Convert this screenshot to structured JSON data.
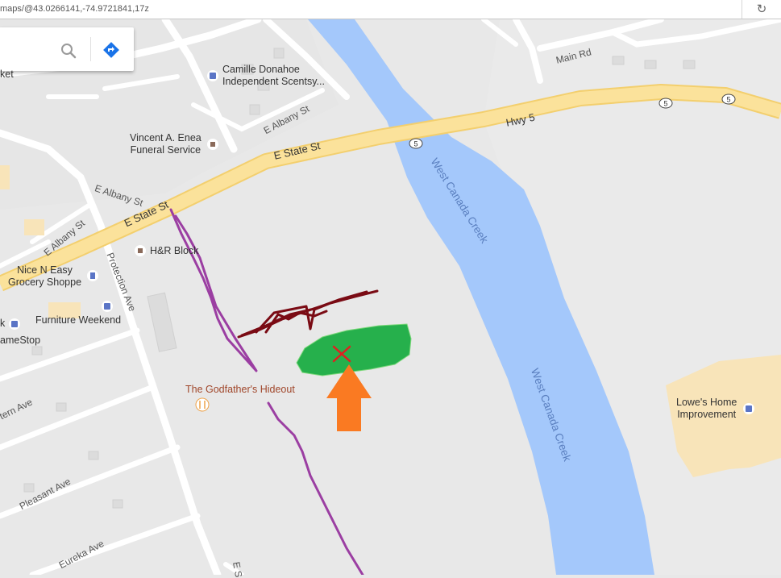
{
  "browser": {
    "url": "maps/@43.0266141,-74.9721841,17z"
  },
  "colors": {
    "land": "#e8e8e8",
    "water": "#a4c8fb",
    "highway": "#fbe29b",
    "highway_stroke": "#f3cf6e",
    "local_road": "#ffffff",
    "commercial": "#f8e4b9",
    "purple_path": "#9b3ea2",
    "dark_red_scribble": "#7a0b14",
    "green_area": "#26b04c",
    "orange_arrow": "#fa7a22",
    "red_x": "#e02020"
  },
  "search_panel": {
    "icons": [
      "search-icon",
      "directions-icon"
    ]
  },
  "labels": {
    "main_rd": "Main Rd",
    "hwy5": "Hwy 5",
    "route_5": "5",
    "e_state_st": "E State St",
    "e_albany_st": "E Albany St",
    "protection_ave": "Protection Ave",
    "pleasant_ave": "Pleasant Ave",
    "eureka_ave": "Eureka Ave",
    "tern_ave": "tern Ave",
    "e_s": "E S",
    "creek": "West Canada Creek"
  },
  "places": {
    "ket": "ket",
    "camille_line1": "Camille Donahoe",
    "camille_line2": "Independent Scentsy...",
    "vincent_line1": "Vincent A. Enea",
    "vincent_line2": "Funeral Service",
    "hr_block": "H&R Block",
    "nice_line1": "Nice N Easy",
    "nice_line2": "Grocery Shoppe",
    "furniture": "Furniture Weekend",
    "k": "k",
    "gamestop": "ameStop",
    "godfather": "The Godfather's Hideout",
    "lowes_line1": "Lowe's Home",
    "lowes_line2": "Improvement"
  }
}
